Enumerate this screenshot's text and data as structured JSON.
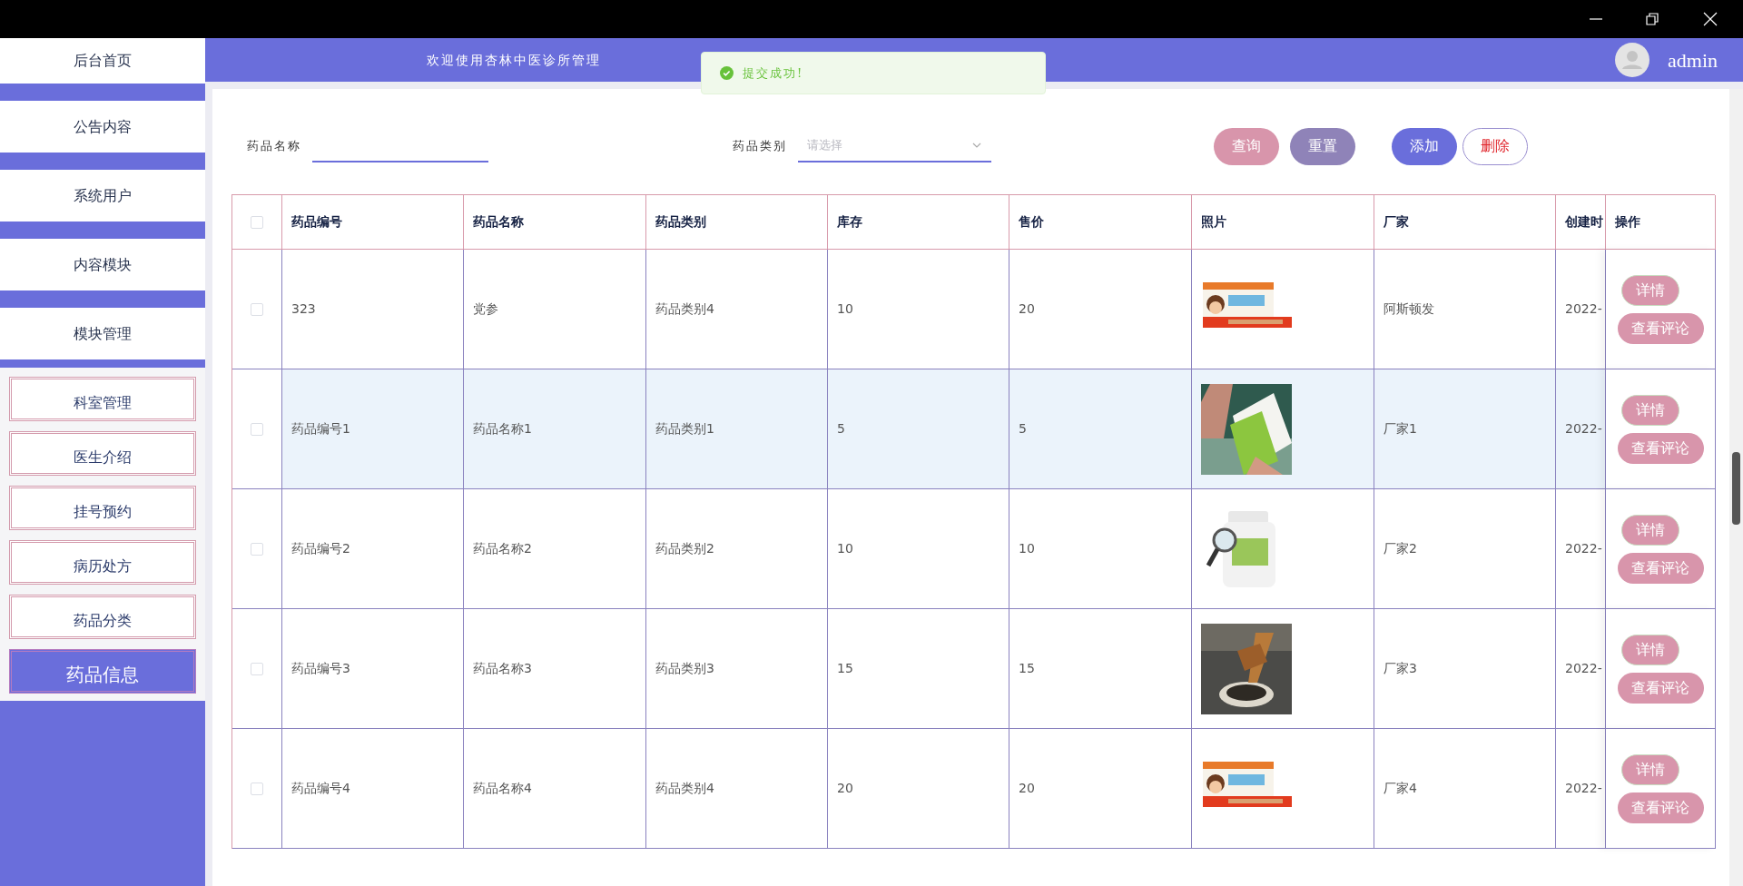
{
  "sidebar": {
    "items": [
      {
        "label": "后台首页"
      },
      {
        "label": "公告内容"
      },
      {
        "label": "系统用户"
      },
      {
        "label": "内容模块"
      },
      {
        "label": "模块管理"
      }
    ],
    "subitems": [
      {
        "label": "科室管理",
        "selected": false
      },
      {
        "label": "医生介绍",
        "selected": false
      },
      {
        "label": "挂号预约",
        "selected": false
      },
      {
        "label": "病历处方",
        "selected": false
      },
      {
        "label": "药品分类",
        "selected": false
      },
      {
        "label": "药品信息",
        "selected": true
      }
    ]
  },
  "header": {
    "title": "欢迎使用杏林中医诊所管理",
    "user": "admin"
  },
  "toast": {
    "message": "提交成功!"
  },
  "search": {
    "fields": [
      {
        "label": "药品名称",
        "kind": "input"
      },
      {
        "label": "药品类别",
        "kind": "select",
        "placeholder": "请选择"
      }
    ],
    "buttons": [
      {
        "label": "查询",
        "kind": "query"
      },
      {
        "label": "重置",
        "kind": "reset"
      },
      {
        "label": "添加",
        "kind": "add"
      },
      {
        "label": "删除",
        "kind": "delete"
      }
    ]
  },
  "table": {
    "header_checked": false,
    "columns": [
      "药品编号",
      "药品名称",
      "药品类别",
      "库存",
      "售价",
      "照片",
      "厂家",
      "创建时",
      "操作"
    ],
    "rows": [
      {
        "checked": false,
        "highlighted": false,
        "cells": [
          "323",
          "党参",
          "药品类别4",
          "10",
          "20",
          {
            "kind": "picture"
          },
          "阿斯顿发",
          "2022-"
        ],
        "actions": [
          "详情",
          "查看评论"
        ]
      },
      {
        "checked": false,
        "highlighted": true,
        "cells": [
          "药品编号1",
          "药品名称1",
          "药品类别1",
          "5",
          "5",
          {
            "kind": "picture"
          },
          "厂家1",
          "2022-"
        ],
        "actions": [
          "详情",
          "查看评论"
        ]
      },
      {
        "checked": false,
        "highlighted": false,
        "cells": [
          "药品编号2",
          "药品名称2",
          "药品类别2",
          "10",
          "10",
          {
            "kind": "picture"
          },
          "厂家2",
          "2022-"
        ],
        "actions": [
          "详情",
          "查看评论"
        ]
      },
      {
        "checked": false,
        "highlighted": false,
        "cells": [
          "药品编号3",
          "药品名称3",
          "药品类别3",
          "15",
          "15",
          {
            "kind": "picture"
          },
          "厂家3",
          "2022-"
        ],
        "actions": [
          "详情",
          "查看评论"
        ]
      },
      {
        "checked": false,
        "highlighted": false,
        "cells": [
          "药品编号4",
          "药品名称4",
          "药品类别4",
          "20",
          "20",
          {
            "kind": "picture"
          },
          "厂家4",
          "2022-"
        ],
        "actions": [
          "详情",
          "查看评论"
        ]
      }
    ]
  }
}
